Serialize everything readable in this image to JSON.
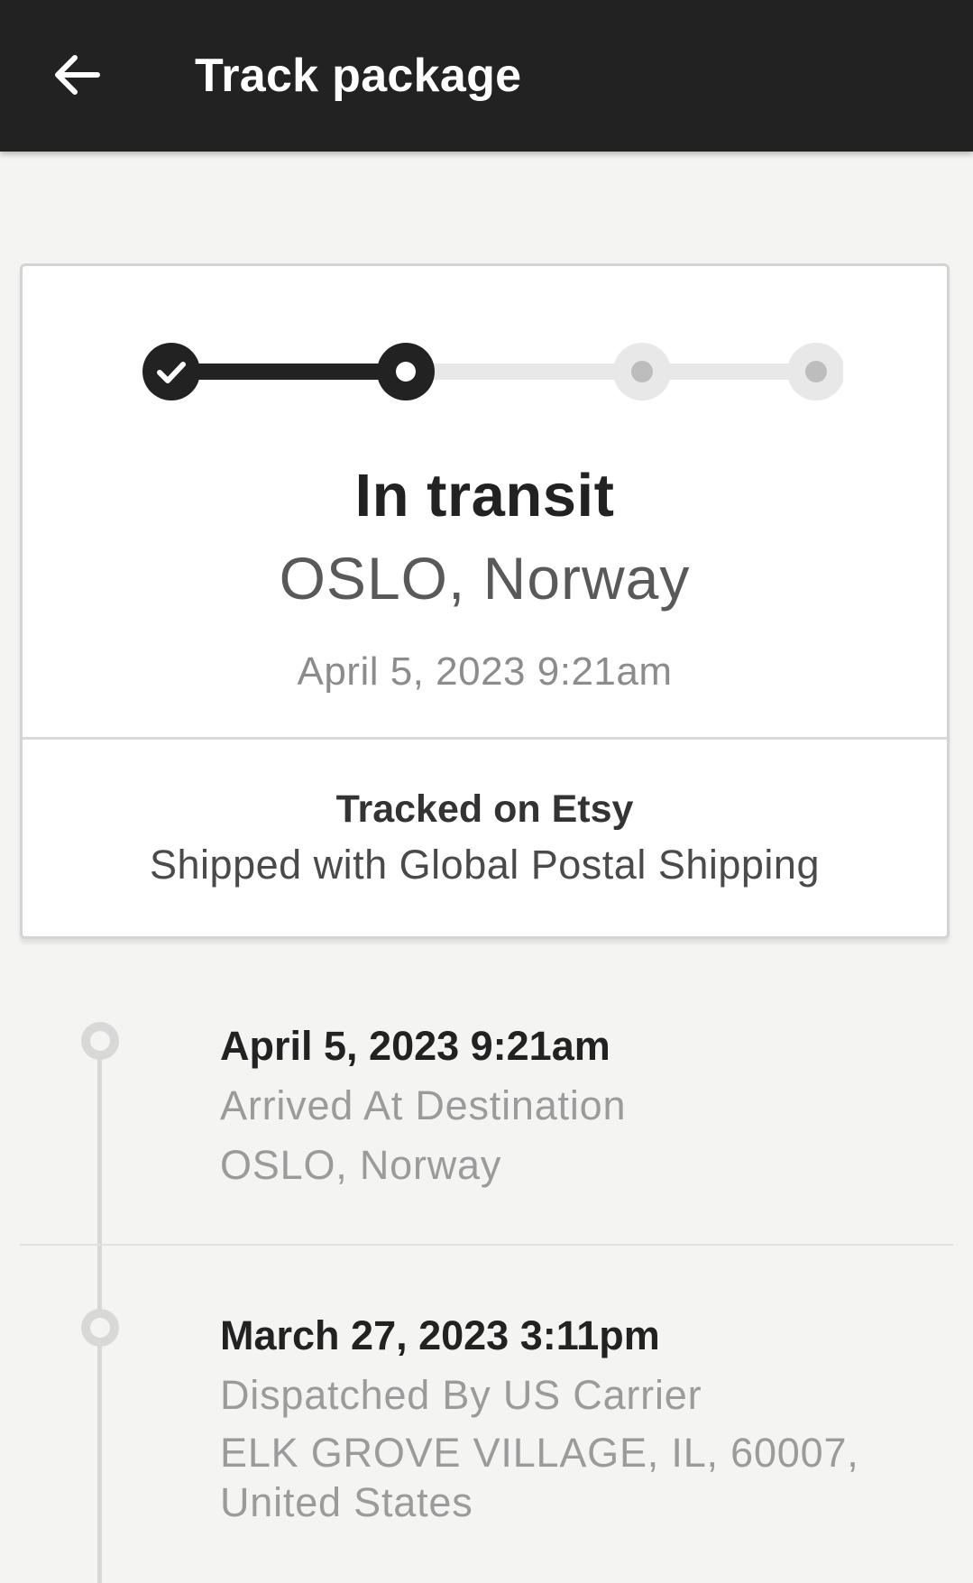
{
  "appbar": {
    "back_icon": "arrow-left-icon",
    "title": "Track package"
  },
  "status_card": {
    "progress": {
      "total_steps": 4,
      "completed_steps": 1,
      "current_step": 2
    },
    "status": "In transit",
    "location": "OSLO, Norway",
    "date": "April 5, 2023 9:21am",
    "tracked_on": "Tracked on Etsy",
    "shipping_method": "Shipped with Global Postal Shipping"
  },
  "events": [
    {
      "date": "April 5, 2023 9:21am",
      "description": "Arrived At Destination",
      "location": "OSLO, Norway"
    },
    {
      "date": "March 27, 2023 3:11pm",
      "description": "Dispatched By US Carrier",
      "location": "ELK GROVE VILLAGE, IL, 60007, United States"
    }
  ],
  "colors": {
    "appbar_bg": "#222222",
    "page_bg": "#f4f4f3",
    "progress_done": "#222222",
    "progress_pending": "#e8e8e8"
  }
}
